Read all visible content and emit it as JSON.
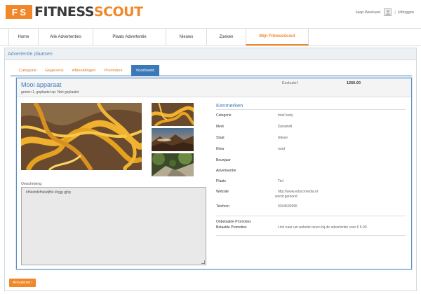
{
  "header": {
    "logo_badge": "F S",
    "logo_word1": "FITNESS",
    "logo_word2": "SCOUT",
    "user_name": "Jaap Weelveel",
    "separator": "|",
    "logout_label": "Uitloggen"
  },
  "nav": {
    "items": [
      {
        "label": "Home"
      },
      {
        "label": "Alle Advertenties"
      },
      {
        "label": "Plaats Advertentie"
      },
      {
        "label": "Nieuws"
      },
      {
        "label": "Zoeken"
      },
      {
        "label": "Mijn FitnessScout",
        "active": true
      }
    ]
  },
  "panel": {
    "title": "Advertentie plaatsen"
  },
  "tabs": [
    {
      "label": "Categorie"
    },
    {
      "label": "Gegevens"
    },
    {
      "label": "Afbeeldingen"
    },
    {
      "label": "Promoties"
    },
    {
      "label": "Voorbeeld",
      "active": true
    }
  ],
  "preview": {
    "title": "Mooi apparaat",
    "subtitle": "gezien 1, geplaatst op: Niet geplaatst",
    "exclusive_label": "Exclusief",
    "price": "1260.00",
    "description_label": "Omschrijving:",
    "description": "kfhkshdkfhskdjfhk khgjg gjhg",
    "kenmerken_title": "Kenmerken",
    "properties": [
      {
        "key": "Categorie",
        "value": "total body"
      },
      {
        "key": "Merk",
        "value": "Dynamdt"
      },
      {
        "key": "Staat",
        "value": "Nieuw"
      },
      {
        "key": "Kleur",
        "value": "rood"
      },
      {
        "key": "Bouwjaar",
        "value": ""
      },
      {
        "key": "Adverteerder",
        "value": ""
      },
      {
        "key": "Plaats",
        "value": "Tiel"
      },
      {
        "key": "Website",
        "value": "http://www.educomedia.nl",
        "value2": "wordt getoond"
      },
      {
        "key": "Telefoon",
        "value": "0344630995"
      }
    ],
    "promotions": {
      "unpaid_label": "Onbetaalde Promoties",
      "paid_label": "Betaalde Promoties",
      "paid_value": "Link naar uw website tonen bij de advertentie voor € 6.00."
    }
  },
  "actions": {
    "cancel_label": "Annuleren !"
  },
  "colors": {
    "accent": "#f0882a",
    "link_blue": "#3f7cbf",
    "tab_active": "#3a78b8"
  }
}
